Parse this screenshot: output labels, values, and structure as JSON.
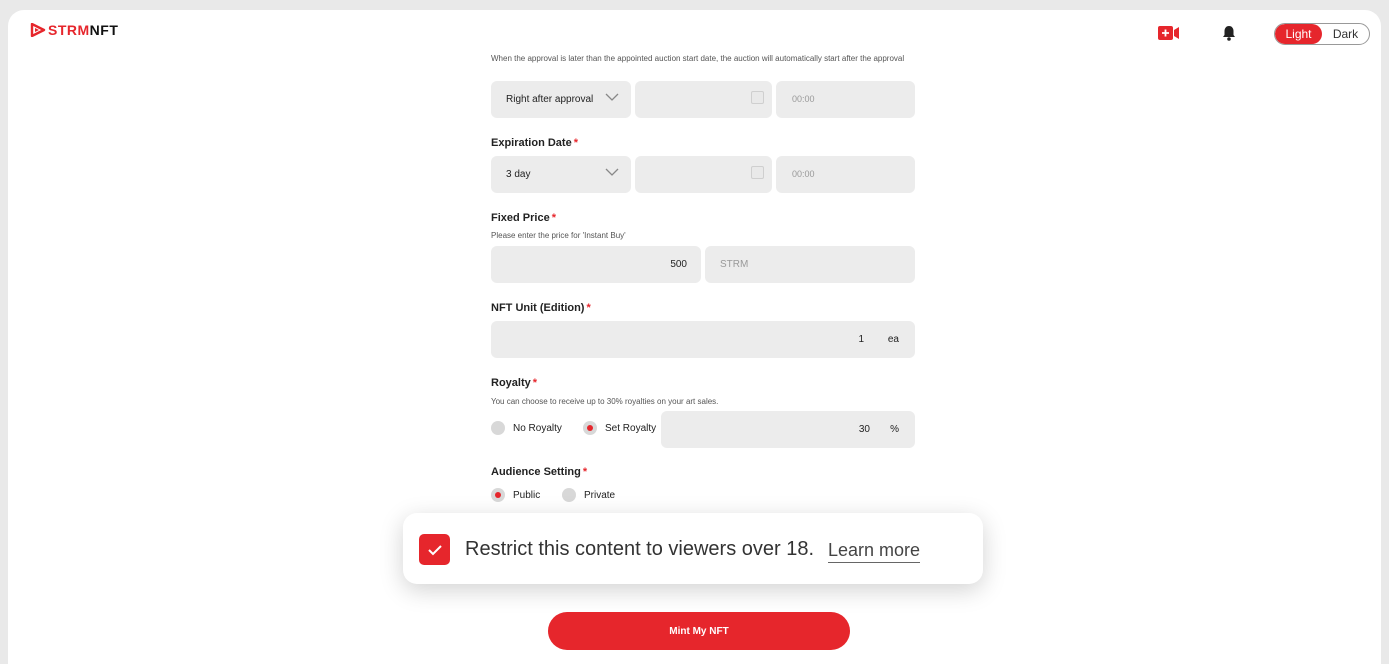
{
  "header": {
    "logo_part1": "STRM",
    "logo_part2": "NFT",
    "theme_light": "Light",
    "theme_dark": "Dark",
    "icons": [
      "live-stream-icon",
      "bell-icon"
    ]
  },
  "auction_start": {
    "note": "When the approval is later than the appointed auction start date, the auction will automatically start after the approval",
    "select_value": "Right after approval",
    "date_value": "",
    "time_placeholder": "00:00"
  },
  "expiration": {
    "label": "Expiration Date",
    "required": "*",
    "select_value": "3 day",
    "date_value": "",
    "time_placeholder": "00:00"
  },
  "fixed_price": {
    "label": "Fixed Price",
    "required": "*",
    "note": "Please enter the price for 'Instant Buy'",
    "value": "500",
    "currency": "STRM"
  },
  "nft_unit": {
    "label": "NFT Unit (Edition)",
    "required": "*",
    "value": "1",
    "unit": "ea"
  },
  "royalty": {
    "label": "Royalty",
    "required": "*",
    "note": "You can choose to receive up to 30% royalties on your art sales.",
    "option_none": "No Royalty",
    "option_set": "Set Royalty",
    "selected": "Set Royalty",
    "value": "30",
    "unit": "%"
  },
  "audience": {
    "label": "Audience Setting",
    "required": "*",
    "option_public": "Public",
    "option_private": "Private",
    "selected": "Public"
  },
  "restrict": {
    "text": "Restrict this content to viewers over 18.",
    "learn_more": "Learn more",
    "checked": true
  },
  "mint_button": "Mint My NFT",
  "colors": {
    "accent": "#e6262c",
    "field_bg": "#ececec"
  }
}
